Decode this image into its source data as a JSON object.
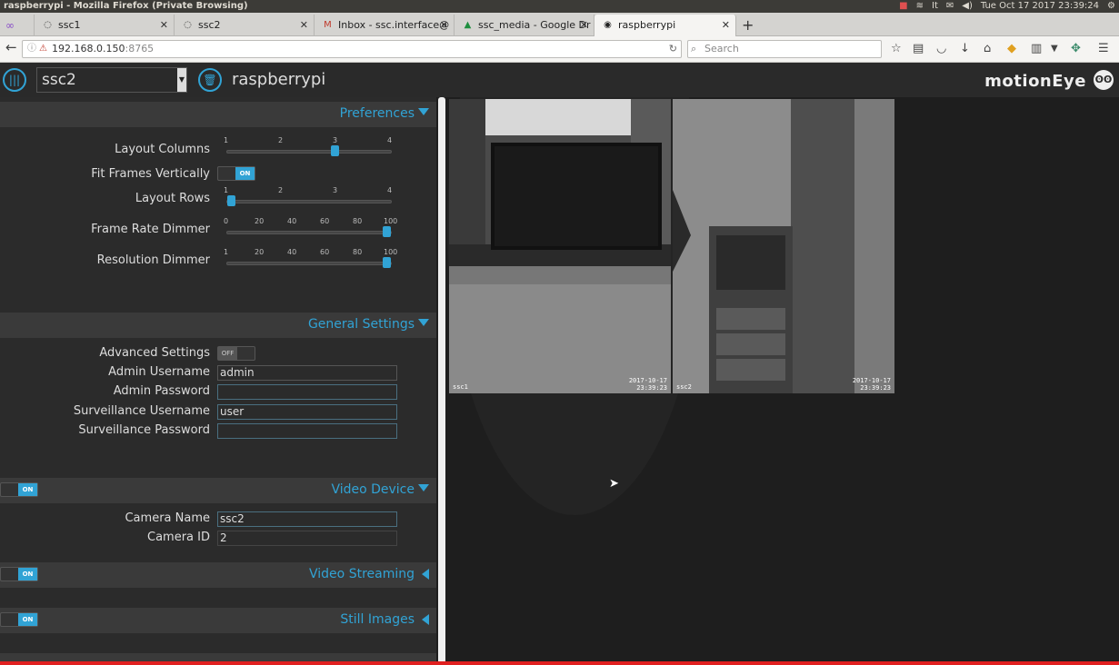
{
  "os": {
    "window_title": "raspberrypi - Mozilla Firefox (Private Browsing)",
    "clock": "Tue Oct 17 2017 23:39:24"
  },
  "tabs": [
    {
      "label": "ssc1"
    },
    {
      "label": "ssc2"
    },
    {
      "label": "Inbox - ssc.interface@"
    },
    {
      "label": "ssc_media - Google Dr"
    },
    {
      "label": "raspberrypi"
    }
  ],
  "nav": {
    "url_host": "192.168.0.150",
    "url_port": ":8765",
    "search_placeholder": "Search"
  },
  "header": {
    "camera_select": "ssc2",
    "hostname": "raspberrypi",
    "brand": "motionEye"
  },
  "preferences": {
    "title": "Preferences",
    "layout_columns": {
      "label": "Layout Columns",
      "ticks": [
        "1",
        "2",
        "3",
        "4"
      ],
      "value": 3,
      "min": 1,
      "max": 4
    },
    "fit_frames": {
      "label": "Fit Frames Vertically",
      "state": "ON"
    },
    "layout_rows": {
      "label": "Layout Rows",
      "ticks": [
        "1",
        "2",
        "3",
        "4"
      ],
      "value": 1,
      "min": 1,
      "max": 4
    },
    "frame_rate_dimmer": {
      "label": "Frame Rate Dimmer",
      "ticks": [
        "0",
        "20",
        "40",
        "60",
        "80",
        "100"
      ],
      "value": 100,
      "min": 0,
      "max": 100
    },
    "resolution_dimmer": {
      "label": "Resolution Dimmer",
      "ticks": [
        "1",
        "20",
        "40",
        "60",
        "80",
        "100"
      ],
      "value": 100,
      "min": 1,
      "max": 100
    }
  },
  "general": {
    "title": "General Settings",
    "advanced": {
      "label": "Advanced Settings",
      "state": "OFF"
    },
    "admin_username": {
      "label": "Admin Username",
      "value": "admin"
    },
    "admin_password": {
      "label": "Admin Password",
      "value": ""
    },
    "surv_username": {
      "label": "Surveillance Username",
      "value": "user"
    },
    "surv_password": {
      "label": "Surveillance Password",
      "value": ""
    }
  },
  "video_device": {
    "title": "Video Device",
    "toggle": "ON",
    "camera_name": {
      "label": "Camera Name",
      "value": "ssc2"
    },
    "camera_id": {
      "label": "Camera ID",
      "value": "2"
    }
  },
  "video_streaming": {
    "title": "Video Streaming",
    "toggle": "ON"
  },
  "still_images": {
    "title": "Still Images",
    "toggle": "ON"
  },
  "frames": [
    {
      "camera": "ssc1",
      "date": "2017-10-17",
      "time": "23:39:23"
    },
    {
      "camera": "ssc2",
      "date": "2017-10-17",
      "time": "23:39:23"
    }
  ],
  "colors": {
    "accent": "#31a3d5",
    "panel": "#2b2b2b",
    "header": "#2a2a2a"
  }
}
